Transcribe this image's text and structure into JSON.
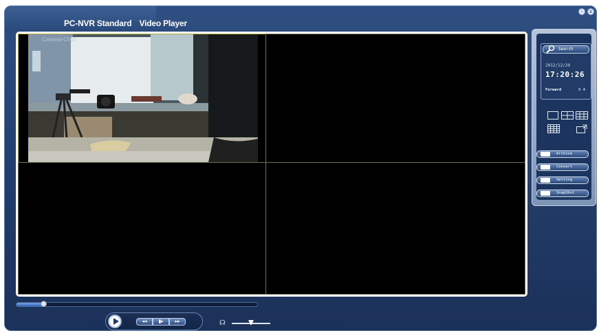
{
  "app": {
    "title_main": "PC-NVR Standard",
    "title_sub": "Video Player",
    "min_glyph": "-",
    "close_glyph": "x"
  },
  "video": {
    "camera_label": "Camera-Ch01"
  },
  "info": {
    "search_label": "Search",
    "date": "2012/12/20",
    "time": "17:20:26",
    "direction": "Forward",
    "speed": "X 4"
  },
  "actions": {
    "archive": "Archive",
    "convert": "Convert",
    "setting": "Setting",
    "snapshot": "SnapShot"
  },
  "playback": {
    "progress": 0.11,
    "rewind_glyph": "◂◂",
    "step_glyph": "▮▸",
    "forward_glyph": "▸▸",
    "volume": 0.5,
    "volume_glyph": "☊"
  },
  "colors": {
    "accent": "#2f64b8",
    "panel": "#223d6a",
    "active_cell_border": "#b8a83a"
  }
}
